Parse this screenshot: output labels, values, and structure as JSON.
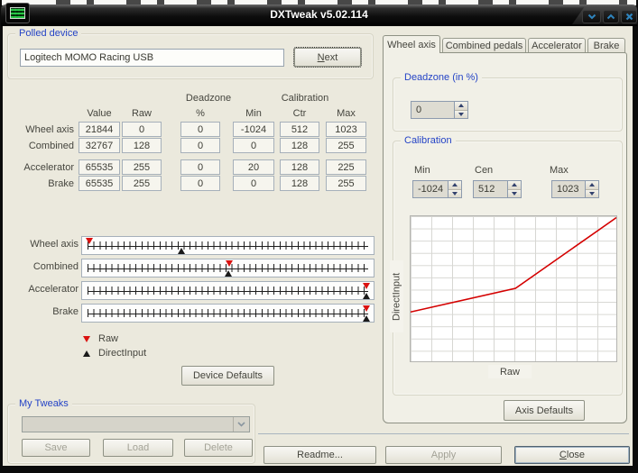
{
  "titlebar": {
    "title": "DXTweak v5.02.114",
    "buttons": [
      {
        "name": "minimize",
        "glyph": "chevron-down"
      },
      {
        "name": "restore",
        "glyph": "chevron-up"
      },
      {
        "name": "close",
        "glyph": "x"
      }
    ],
    "glyph_color": "#2f84bd"
  },
  "polled_device": {
    "label": "Polled device",
    "device_name": "Logitech MOMO Racing USB",
    "next_button": "Next"
  },
  "axis_table": {
    "span_headers": {
      "deadzone": "Deadzone",
      "calibration": "Calibration"
    },
    "columns": [
      "Value",
      "Raw",
      "%",
      "Min",
      "Ctr",
      "Max"
    ],
    "rows": [
      {
        "label": "Wheel axis",
        "value": "21844",
        "raw": "0",
        "dz": "0",
        "min": "-1024",
        "ctr": "512",
        "max": "1023"
      },
      {
        "label": "Combined",
        "value": "32767",
        "raw": "128",
        "dz": "0",
        "min": "0",
        "ctr": "128",
        "max": "255"
      },
      {
        "label": "Accelerator",
        "value": "65535",
        "raw": "255",
        "dz": "0",
        "min": "20",
        "ctr": "128",
        "max": "225"
      },
      {
        "label": "Brake",
        "value": "65535",
        "raw": "255",
        "dz": "0",
        "min": "0",
        "ctr": "128",
        "max": "255"
      }
    ]
  },
  "sliders": {
    "rows": [
      {
        "label": "Wheel axis",
        "raw_pct": 0.8,
        "di_pct": 33.3
      },
      {
        "label": "Combined",
        "raw_pct": 50.4,
        "di_pct": 50.0
      },
      {
        "label": "Accelerator",
        "raw_pct": 99.3,
        "di_pct": 99.3
      },
      {
        "label": "Brake",
        "raw_pct": 99.3,
        "di_pct": 99.3
      }
    ],
    "legend": [
      {
        "icon": "raw-marker",
        "label": "Raw",
        "color": "#da1210"
      },
      {
        "icon": "directinput-marker",
        "label": "DirectInput",
        "color": "#1a1a1a"
      }
    ]
  },
  "buttons": {
    "device_defaults": "Device Defaults",
    "axis_defaults": "Axis Defaults",
    "save": "Save",
    "load": "Load",
    "delete": "Delete",
    "readme": "Readme...",
    "apply": "Apply",
    "close": "Close"
  },
  "my_tweaks": {
    "label": "My Tweaks",
    "combo_value": ""
  },
  "tabs": [
    {
      "label": "Wheel axis",
      "active": true
    },
    {
      "label": "Combined pedals",
      "active": false
    },
    {
      "label": "Accelerator",
      "active": false
    },
    {
      "label": "Brake",
      "active": false
    }
  ],
  "axis_panel": {
    "deadzone_label": "Deadzone (in %)",
    "deadzone_value": "0",
    "calibration_label": "Calibration",
    "cal_fields": [
      {
        "label": "Min",
        "value": "-1024"
      },
      {
        "label": "Cen",
        "value": "512"
      },
      {
        "label": "Max",
        "value": "1023"
      }
    ]
  },
  "chart_data": {
    "type": "line",
    "title": "",
    "xlabel": "Raw",
    "ylabel": "DirectInput",
    "axis_ticks": "none shown",
    "grid": {
      "cols": 10,
      "rows": 12,
      "color": "#d7d7d3",
      "on": true
    },
    "legend_position": "none",
    "series": [
      {
        "name": "raw-to-directinput-calibration-curve",
        "color": "#d40000",
        "points_norm": [
          [
            0,
            0.34
          ],
          [
            0.51,
            0.503
          ],
          [
            1.0,
            0.99
          ]
        ]
      }
    ]
  }
}
